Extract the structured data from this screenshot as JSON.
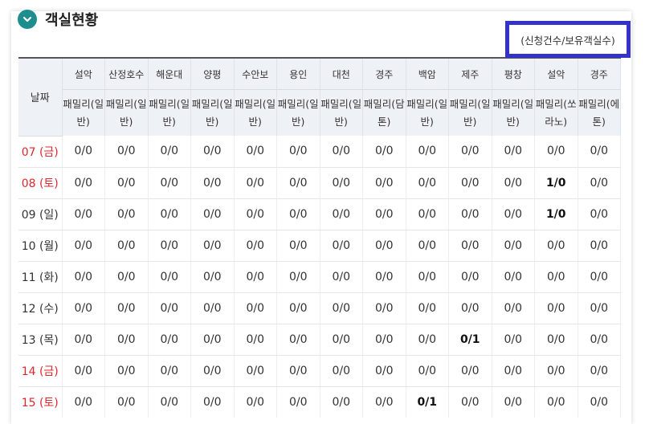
{
  "section": {
    "title": "객실현황",
    "legend": "(신청건수/보유객실수)"
  },
  "colors": {
    "accent": "#1e8d8d",
    "legend_border": "#3333cc",
    "holiday": "#e0262b"
  },
  "icons": {
    "toggle": "chevron-down-icon"
  },
  "table": {
    "date_header": "날짜",
    "resorts": [
      "설악",
      "산정호수",
      "해운대",
      "양평",
      "수안보",
      "용인",
      "대천",
      "경주",
      "백암",
      "제주",
      "평창",
      "설악",
      "경주"
    ],
    "room_types": [
      [
        "패밀리(일",
        "반)"
      ],
      [
        "패밀리(일",
        "반)"
      ],
      [
        "패밀리(일",
        "반)"
      ],
      [
        "패밀리(일",
        "반)"
      ],
      [
        "패밀리(일",
        "반)"
      ],
      [
        "패밀리(일",
        "반)"
      ],
      [
        "패밀리(일",
        "반)"
      ],
      [
        "패밀리(담",
        "톤)"
      ],
      [
        "패밀리(일",
        "반)"
      ],
      [
        "패밀리(일",
        "반)"
      ],
      [
        "패밀리(일",
        "반)"
      ],
      [
        "패밀리(쏘",
        "라노)"
      ],
      [
        "패밀리(에",
        "톤)"
      ]
    ],
    "rows": [
      {
        "date": "07 (금)",
        "holiday": true,
        "values": [
          "0/0",
          "0/0",
          "0/0",
          "0/0",
          "0/0",
          "0/0",
          "0/0",
          "0/0",
          "0/0",
          "0/0",
          "0/0",
          "0/0",
          "0/0"
        ]
      },
      {
        "date": "08 (토)",
        "holiday": true,
        "values": [
          "0/0",
          "0/0",
          "0/0",
          "0/0",
          "0/0",
          "0/0",
          "0/0",
          "0/0",
          "0/0",
          "0/0",
          "0/0",
          "1/0",
          "0/0"
        ]
      },
      {
        "date": "09 (일)",
        "holiday": false,
        "values": [
          "0/0",
          "0/0",
          "0/0",
          "0/0",
          "0/0",
          "0/0",
          "0/0",
          "0/0",
          "0/0",
          "0/0",
          "0/0",
          "1/0",
          "0/0"
        ]
      },
      {
        "date": "10 (월)",
        "holiday": false,
        "values": [
          "0/0",
          "0/0",
          "0/0",
          "0/0",
          "0/0",
          "0/0",
          "0/0",
          "0/0",
          "0/0",
          "0/0",
          "0/0",
          "0/0",
          "0/0"
        ]
      },
      {
        "date": "11 (화)",
        "holiday": false,
        "values": [
          "0/0",
          "0/0",
          "0/0",
          "0/0",
          "0/0",
          "0/0",
          "0/0",
          "0/0",
          "0/0",
          "0/0",
          "0/0",
          "0/0",
          "0/0"
        ]
      },
      {
        "date": "12 (수)",
        "holiday": false,
        "values": [
          "0/0",
          "0/0",
          "0/0",
          "0/0",
          "0/0",
          "0/0",
          "0/0",
          "0/0",
          "0/0",
          "0/0",
          "0/0",
          "0/0",
          "0/0"
        ]
      },
      {
        "date": "13 (목)",
        "holiday": false,
        "values": [
          "0/0",
          "0/0",
          "0/0",
          "0/0",
          "0/0",
          "0/0",
          "0/0",
          "0/0",
          "0/0",
          "0/1",
          "0/0",
          "0/0",
          "0/0"
        ]
      },
      {
        "date": "14 (금)",
        "holiday": true,
        "values": [
          "0/0",
          "0/0",
          "0/0",
          "0/0",
          "0/0",
          "0/0",
          "0/0",
          "0/0",
          "0/0",
          "0/0",
          "0/0",
          "0/0",
          "0/0"
        ]
      },
      {
        "date": "15 (토)",
        "holiday": true,
        "values": [
          "0/0",
          "0/0",
          "0/0",
          "0/0",
          "0/0",
          "0/0",
          "0/0",
          "0/0",
          "0/1",
          "0/0",
          "0/0",
          "0/0",
          "0/0"
        ]
      }
    ]
  }
}
